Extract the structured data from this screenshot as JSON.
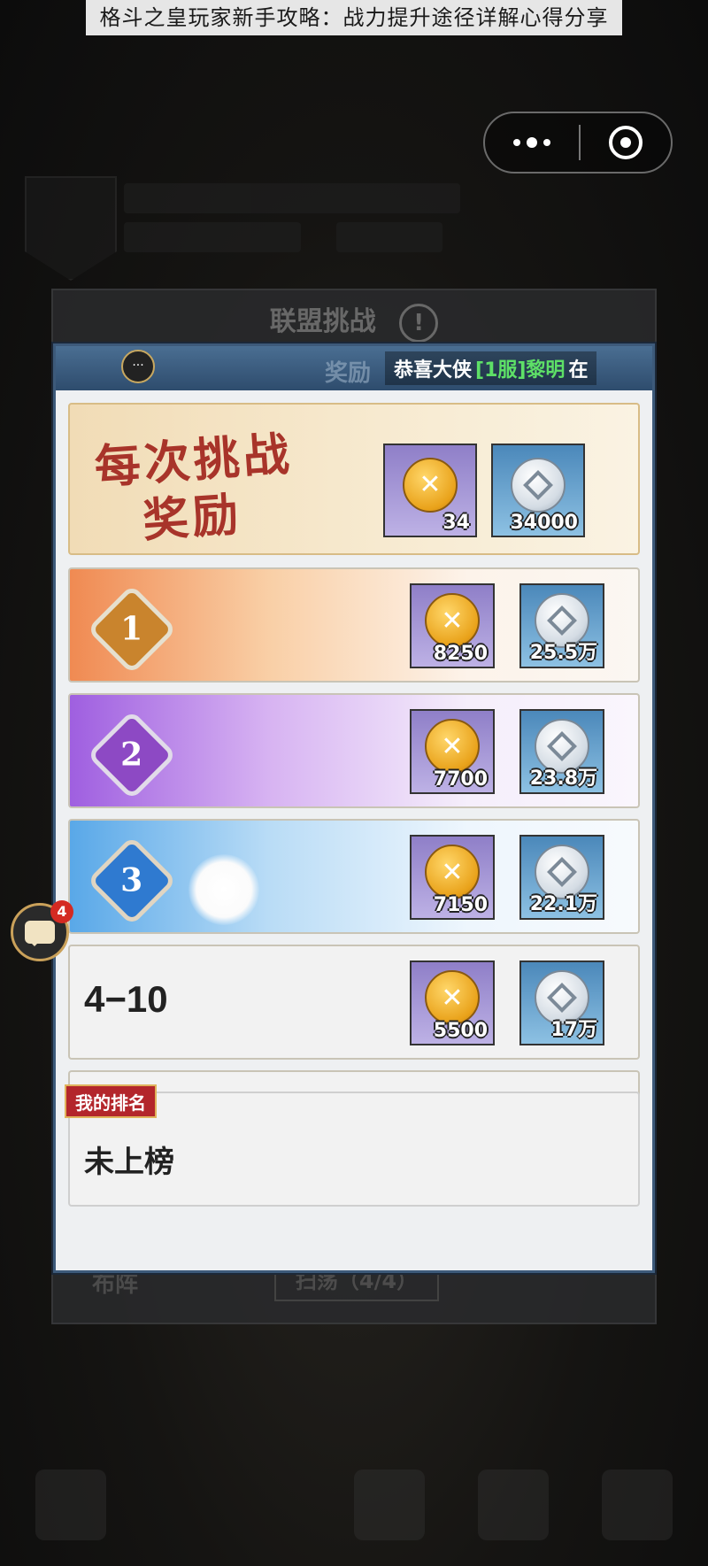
{
  "banner": {
    "title": "格斗之皇玩家新手攻略：战力提升途径详解心得分享"
  },
  "outer_panel": {
    "title": "联盟挑战",
    "bottom_left": "布阵",
    "bottom_btn": "扫荡（4/4）"
  },
  "panel": {
    "header_title": "奖励",
    "ticker": {
      "prefix": "恭喜大侠",
      "server": "[1服]黎明",
      "suffix": "在"
    },
    "top_reward": {
      "label_line1": "每次挑战",
      "label_line2": "奖励",
      "items": [
        {
          "icon": "gold-coin-icon",
          "qty": "34"
        },
        {
          "icon": "silver-coin-icon",
          "qty": "34000"
        }
      ]
    },
    "ranks": [
      {
        "badge": "1",
        "items": [
          {
            "icon": "gold-coin-icon",
            "qty": "8250"
          },
          {
            "icon": "silver-coin-icon",
            "qty": "25.5万"
          }
        ]
      },
      {
        "badge": "2",
        "items": [
          {
            "icon": "gold-coin-icon",
            "qty": "7700"
          },
          {
            "icon": "silver-coin-icon",
            "qty": "23.8万"
          }
        ]
      },
      {
        "badge": "3",
        "items": [
          {
            "icon": "gold-coin-icon",
            "qty": "7150"
          },
          {
            "icon": "silver-coin-icon",
            "qty": "22.1万"
          }
        ]
      },
      {
        "label": "4−10",
        "items": [
          {
            "icon": "gold-coin-icon",
            "qty": "5500"
          },
          {
            "icon": "silver-coin-icon",
            "qty": "17万"
          }
        ]
      }
    ],
    "my_rank": {
      "tag": "我的排名",
      "value": "未上榜"
    }
  },
  "chat": {
    "unread": "4"
  },
  "colors": {
    "panel_border": "#3d5a7a",
    "rank_tag": "#b3262b",
    "ticker_green": "#5ee067"
  }
}
